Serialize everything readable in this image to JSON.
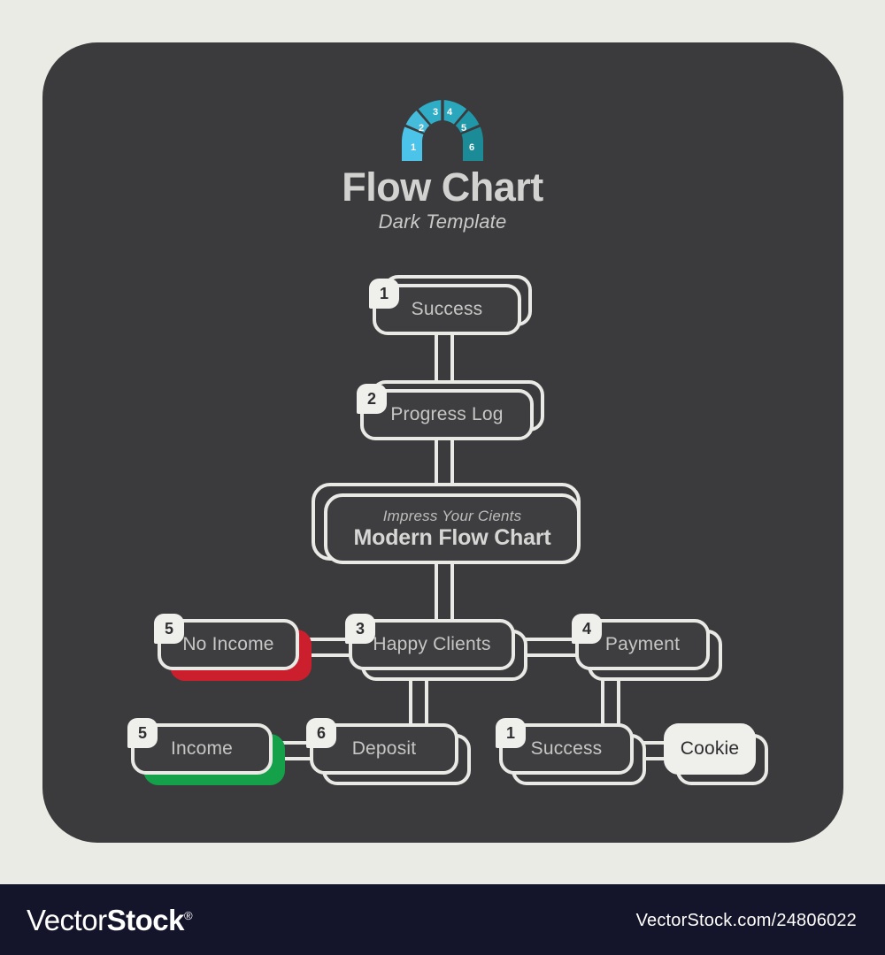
{
  "header": {
    "title": "Flow Chart",
    "subtitle": "Dark Template",
    "logo_icon": "gauge-segments-icon",
    "logo_segments": [
      {
        "label": "1",
        "color": "#4cc3e8"
      },
      {
        "label": "2",
        "color": "#46bcdc"
      },
      {
        "label": "3",
        "color": "#2fadc6"
      },
      {
        "label": "4",
        "color": "#2ba7bd"
      },
      {
        "label": "5",
        "color": "#2097a8"
      },
      {
        "label": "6",
        "color": "#1b8b97"
      }
    ]
  },
  "theme": {
    "page_background": "#ebebe6",
    "panel_background": "#3b3b3d",
    "card_background": "#3e3e40",
    "outline": "#e9e9e6",
    "text": "#c6c7c5",
    "accent_red": "#cc1f2e",
    "accent_green": "#15a04a",
    "accent_blue": "#2fadc6",
    "footer_background": "#14142a"
  },
  "nodes": {
    "success_top": {
      "number": "1",
      "label": "Success"
    },
    "progress_log": {
      "number": "2",
      "label": "Progress Log"
    },
    "center": {
      "sub": "Impress Your Cients",
      "main": "Modern Flow Chart"
    },
    "no_income": {
      "number": "5",
      "label": "No Income",
      "accent": "red"
    },
    "happy_clients": {
      "number": "3",
      "label": "Happy Clients"
    },
    "payment": {
      "number": "4",
      "label": "Payment"
    },
    "income": {
      "number": "5",
      "label": "Income",
      "accent": "green"
    },
    "deposit": {
      "number": "6",
      "label": "Deposit"
    },
    "success_bottom": {
      "number": "1",
      "label": "Success"
    },
    "cookie": {
      "label": "Cookie"
    }
  },
  "chart_data": {
    "type": "diagram",
    "title": "Flow Chart",
    "subtitle": "Dark Template",
    "nodes": [
      {
        "id": "success_top",
        "number": 1,
        "label": "Success",
        "level": 0
      },
      {
        "id": "progress_log",
        "number": 2,
        "label": "Progress Log",
        "level": 1
      },
      {
        "id": "center",
        "label": "Modern Flow Chart",
        "sublabel": "Impress Your Cients",
        "level": 2
      },
      {
        "id": "no_income",
        "number": 5,
        "label": "No Income",
        "level": 3,
        "accent": "#cc1f2e"
      },
      {
        "id": "happy_clients",
        "number": 3,
        "label": "Happy Clients",
        "level": 3
      },
      {
        "id": "payment",
        "number": 4,
        "label": "Payment",
        "level": 3
      },
      {
        "id": "income",
        "number": 5,
        "label": "Income",
        "level": 4,
        "accent": "#15a04a"
      },
      {
        "id": "deposit",
        "number": 6,
        "label": "Deposit",
        "level": 4
      },
      {
        "id": "success_bottom",
        "number": 1,
        "label": "Success",
        "level": 4
      },
      {
        "id": "cookie",
        "label": "Cookie",
        "level": 4,
        "style": "inverted"
      }
    ],
    "edges": [
      {
        "from": "success_top",
        "to": "progress_log"
      },
      {
        "from": "progress_log",
        "to": "center"
      },
      {
        "from": "center",
        "to": "happy_clients"
      },
      {
        "from": "happy_clients",
        "to": "no_income"
      },
      {
        "from": "happy_clients",
        "to": "payment"
      },
      {
        "from": "happy_clients",
        "to": "deposit"
      },
      {
        "from": "income",
        "to": "deposit"
      },
      {
        "from": "payment",
        "to": "success_bottom"
      },
      {
        "from": "success_bottom",
        "to": "cookie"
      }
    ]
  },
  "footer": {
    "brand_prefix": "Vector",
    "brand_suffix": "Stock",
    "brand_mark": "®",
    "url": "VectorStock.com/24806022"
  }
}
